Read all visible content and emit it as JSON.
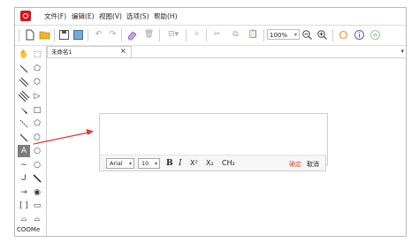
{
  "menu": [
    "文件(F)",
    "编辑(E)",
    "视图(V)",
    "选项(S)",
    "帮助(H)"
  ],
  "toolbar": {
    "zoom_value": "100%",
    "icons": [
      "new-file-icon",
      "open-folder-icon",
      "save-icon",
      "save-as-icon",
      "undo-icon",
      "redo-icon",
      "eraser-icon",
      "delete-icon",
      "align-icon",
      "clean-icon",
      "cut-icon",
      "copy-icon",
      "paste-icon",
      "zoom-out-icon",
      "zoom-in-icon",
      "ring-icon",
      "info-icon",
      "export-icon"
    ]
  },
  "tab": {
    "label": "未命名1",
    "close": "×"
  },
  "palette": {
    "tools": [
      "hand-tool",
      "lasso-tool",
      "single-bond-tool",
      "pentagon-tool",
      "double-bond-tool",
      "hexagon-outline-tool",
      "triple-bond-tool",
      "triangle-tool",
      "wedge-bond-tool",
      "square-tool",
      "hash-bond-tool",
      "pentagon-tool-2",
      "plain-bond-tool",
      "hexagon-tool",
      "text-tool",
      "heptagon-tool",
      "wavy-bond-tool",
      "octagon-tool",
      "curve-arrow-tool",
      "line-tool",
      "arrow-tool",
      "circle-dot-tool",
      "bracket-tool",
      "rectangle-tool",
      "wave-line-tool",
      "bracket-shape-tool"
    ],
    "text_tool_label": "A",
    "coome_label": "COOMe"
  },
  "formatting": {
    "font": "Arial",
    "size": "10",
    "bold": "B",
    "italic": "I",
    "superscript": "X²",
    "subscript": "X₂",
    "chem": "CH₂",
    "ok_label": "确定",
    "cancel_label": "取消"
  },
  "colors": {
    "accent": "#d2191e",
    "arrow": "#e53935",
    "ok": "#e0502e"
  }
}
